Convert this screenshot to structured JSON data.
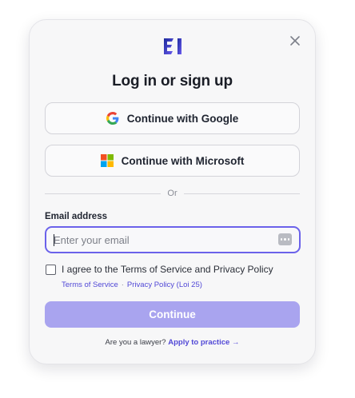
{
  "modal": {
    "title": "Log in or sign up",
    "logo_icon": "brand-logo-icon",
    "close_icon": "close-icon"
  },
  "sso": {
    "google_label": "Continue with Google",
    "microsoft_label": "Continue with Microsoft"
  },
  "divider": {
    "label": "Or"
  },
  "email": {
    "label": "Email address",
    "placeholder": "Enter your email",
    "value": "",
    "icon": "password-manager-icon"
  },
  "terms": {
    "checked": false,
    "label": "I agree to the Terms of Service and Privacy Policy",
    "tos_link": "Terms of Service",
    "separator": "·",
    "privacy_link": "Privacy Policy (Loi 25)"
  },
  "continue_button": {
    "label": "Continue",
    "disabled": true
  },
  "footer": {
    "prompt": "Are you a lawyer?",
    "link": "Apply to practice →"
  },
  "colors": {
    "accent": "#6b62ea",
    "link": "#5148d6",
    "button_disabled": "#a9a4ef",
    "card_bg": "#f7f7f8"
  }
}
